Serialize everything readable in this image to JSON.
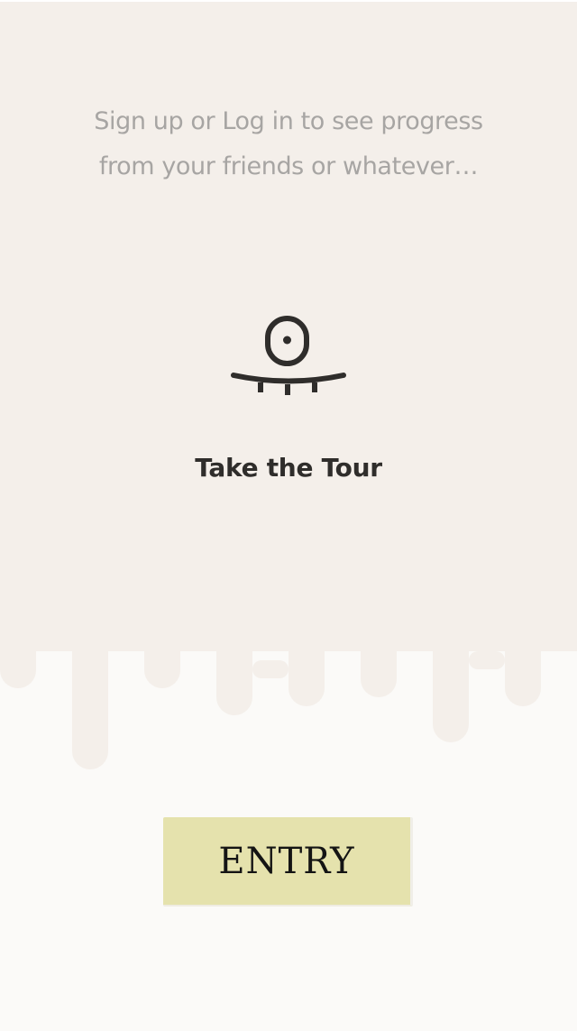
{
  "colors": {
    "upper_background": "#f4efea",
    "lower_background": "#fbfaf8",
    "tagline_text": "#a7a5a3",
    "icon_and_label": "#2f2d2b",
    "entry_button": "#e5e2ad"
  },
  "intro": {
    "tagline_line1": "Sign up or Log in to see progress",
    "tagline_line2": "from your friends or whatever…"
  },
  "tour": {
    "icon": "cyclops-monster-icon",
    "label": "Take the Tour"
  },
  "entry": {
    "label": "ENTRY"
  }
}
